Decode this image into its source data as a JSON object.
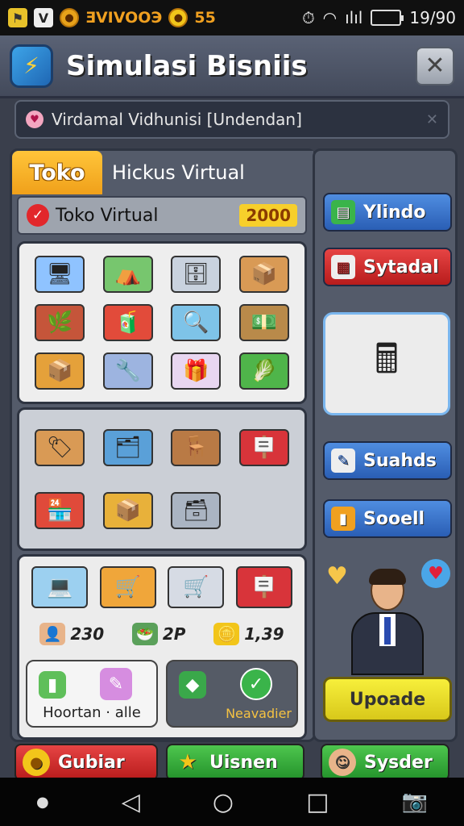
{
  "status_bar": {
    "coins_text": "ƎVIVOOЭ",
    "gold_value": "55",
    "signal_text": "ılıl",
    "time": "19/90",
    "accent_colors": {
      "coins": "#f0a020",
      "battery": "#31c431"
    }
  },
  "header": {
    "title": "Simulasi Bisniis",
    "close_icon": "close-icon",
    "logo_icon": "app-logo"
  },
  "notice": {
    "text": "Virdamal Vidhunisi [Undendan]"
  },
  "main": {
    "tabs": [
      {
        "label": "Toko",
        "active": true
      },
      {
        "label": "Hickus Virtual",
        "active": false
      }
    ],
    "shop_bar": {
      "label": "Toko Virtual",
      "count": "2000"
    },
    "prices": [
      {
        "value": "230"
      },
      {
        "value": "2P"
      },
      {
        "value": "1,39"
      }
    ],
    "cards": [
      {
        "label": "Hoortan · alle"
      },
      {
        "label": "Neavadier"
      }
    ]
  },
  "side": {
    "buttons": [
      {
        "label": "Ylindo",
        "color": "#2a5eb5"
      },
      {
        "label": "Sytadal",
        "color": "#b81c1c"
      },
      {
        "label": "Suahds",
        "color": "#2a5eb5"
      },
      {
        "label": "Sooell",
        "color": "#2a5eb5"
      }
    ],
    "upgrade_label": "Upoade"
  },
  "bottom": {
    "buttons": [
      {
        "label": "Gubiar",
        "color": "#b81c1c"
      },
      {
        "label": "Uisnen",
        "color": "#24922b"
      },
      {
        "label": "Sysder",
        "color": "#24922b"
      }
    ]
  }
}
